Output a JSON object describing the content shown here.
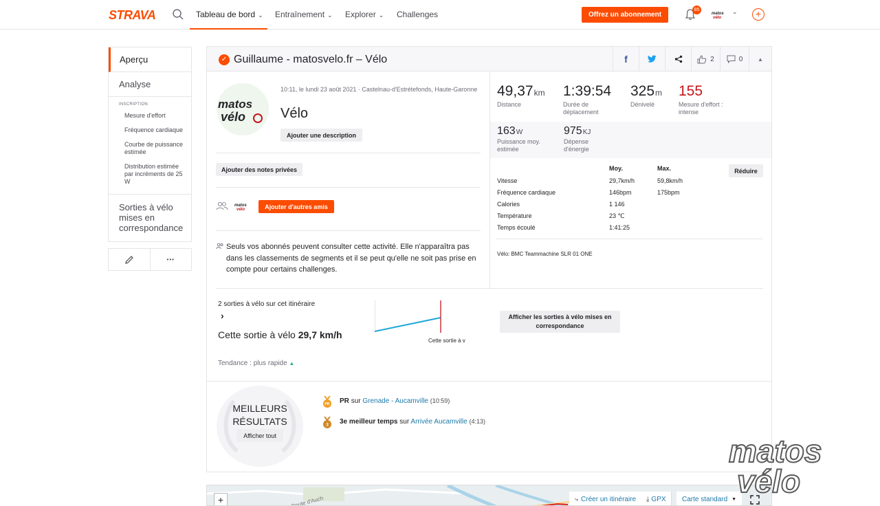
{
  "nav": {
    "logo": "STRAVA",
    "items": [
      {
        "label": "Tableau de bord",
        "has_chevron": true
      },
      {
        "label": "Entraînement",
        "has_chevron": true
      },
      {
        "label": "Explorer",
        "has_chevron": true
      },
      {
        "label": "Challenges",
        "has_chevron": false
      }
    ],
    "subscribe_label": "Offrez un abonnement",
    "notification_count": "85",
    "accent_color": "#fc4c02"
  },
  "sidebar": {
    "items": [
      "Aperçu",
      "Analyse"
    ],
    "section_title": "INSCRIPTION",
    "sub_items": [
      "Mesure d'effort",
      "Fréquence cardiaque",
      "Courbe de puissance estimée",
      "Distribution estimée par incréments de 25 W"
    ],
    "matched_label": "Sorties à vélo mises en correspondance",
    "edit_icon": "pencil-icon",
    "more_icon": "more-icon",
    "more_glyph": "•••"
  },
  "activity": {
    "title": "Guillaume - matosvelo.fr – Vélo",
    "meta": "10:11, le lundi 23 août 2021 · Castelnau-d'Estrétefonds, Haute-Garonne",
    "type": "Vélo",
    "add_description": "Ajouter une description",
    "add_private_notes": "Ajouter des notes privées",
    "add_friends": "Ajouter d'autres amis",
    "privacy_note": "Seuls vos abonnés peuvent consulter cette activité. Elle n'apparaîtra pas dans les classements de segments et il se peut qu'elle ne soit pas prise en compte pour certains challenges.",
    "kudos_count": "2",
    "comment_count": "0",
    "avatar_text_1": "matos",
    "avatar_text_2": "vélo"
  },
  "stats": {
    "primary": [
      {
        "value": "49,37",
        "unit": "km",
        "label": "Distance"
      },
      {
        "value": "1:39:54",
        "unit": "",
        "label": "Durée de déplacement"
      },
      {
        "value": "325",
        "unit": "m",
        "label": "Dénivelé"
      },
      {
        "value": "155",
        "unit": "",
        "label": "Mesure d'effort : intense"
      }
    ],
    "secondary": [
      {
        "value": "163",
        "unit": "W",
        "label": "Puissance moy. estimée"
      },
      {
        "value": "975",
        "unit": "KJ",
        "label": "Dépense d'énergie"
      }
    ],
    "effort_color": "#c4161c",
    "table_headers": [
      "Moy.",
      "Max."
    ],
    "reduce_label": "Réduire",
    "rows": [
      {
        "label": "Vitesse",
        "avg": "29,7km/h",
        "max": "59,8km/h"
      },
      {
        "label": "Fréquence cardiaque",
        "avg": "146bpm",
        "max": "175bpm"
      },
      {
        "label": "Calories",
        "avg": "1 146",
        "max": ""
      },
      {
        "label": "Température",
        "avg": "23 ℃",
        "max": ""
      },
      {
        "label": "Temps écoulé",
        "avg": "1:41:25",
        "max": ""
      }
    ],
    "bike": "Vélo: BMC Teammachine SLR 01 ONE"
  },
  "matched": {
    "count_label": "2 sorties à vélo sur cet itinéraire",
    "chevron": "›",
    "this_ride_prefix": "Cette sortie à vélo",
    "this_ride_value": "29,7",
    "this_ride_unit": "km/h",
    "trend": "Tendance : plus rapide",
    "trend_arrow": "▲",
    "chart_label": "Cette sortie à v",
    "show_matched": "Afficher les sorties à vélo mises en correspondance",
    "line_color": "#1ea7d8",
    "marker_color": "#c4161c"
  },
  "results": {
    "title_1": "MEILLEURS",
    "title_2": "RÉSULTATS",
    "show_all": "Afficher tout",
    "items": [
      {
        "medal": "PR",
        "prefix": "PR",
        "sep": "sur",
        "segment": "Grenade - Aucamville",
        "time": "(10:59)"
      },
      {
        "medal": "3",
        "prefix": "3e meilleur temps",
        "sep": "sur",
        "segment": "Arrivée Aucamville",
        "time": "(4:13)"
      }
    ],
    "link_color": "#1d7aa8",
    "medal_color": "#f0a028"
  },
  "map": {
    "zoom_in": "+",
    "street": "Route d'Auch",
    "create_route": "Créer un itinéraire",
    "gpx": "GPX",
    "map_type": "Carte standard",
    "fullscreen_icon": "expand-icon"
  },
  "watermark": {
    "line1": "matos",
    "line2": "vélo"
  }
}
